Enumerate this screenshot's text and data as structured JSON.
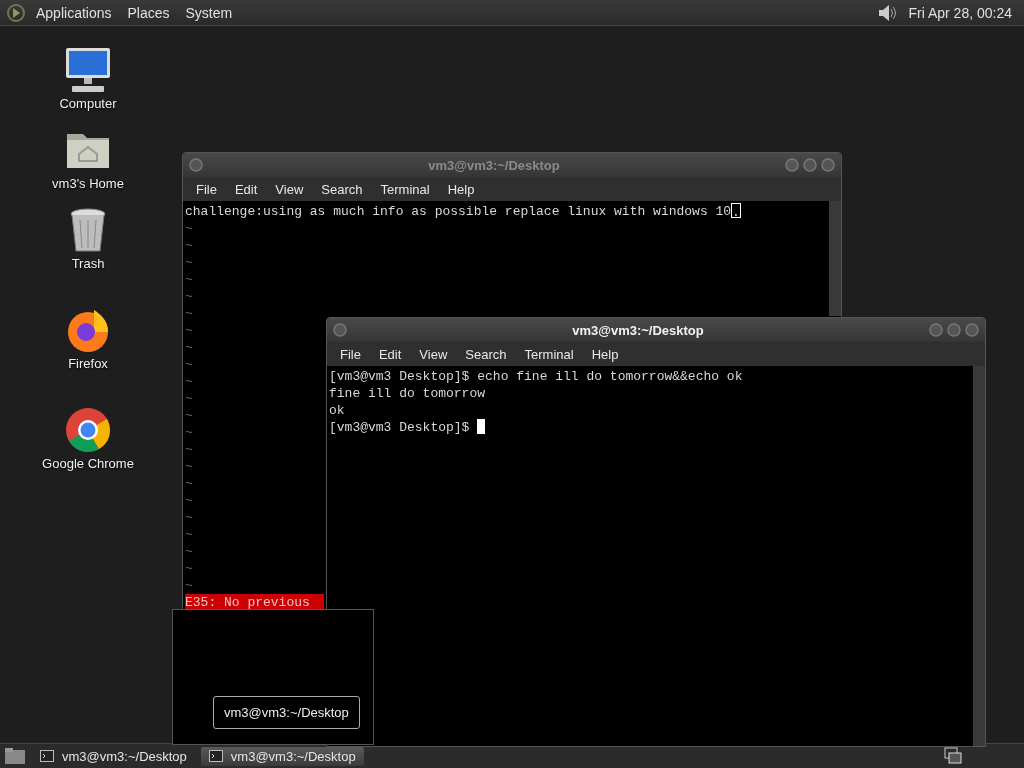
{
  "top_panel": {
    "menus": [
      {
        "label": "Applications"
      },
      {
        "label": "Places"
      },
      {
        "label": "System"
      }
    ],
    "clock": "Fri Apr 28, 00:24"
  },
  "desktop_icons": [
    {
      "kind": "computer",
      "label": "Computer"
    },
    {
      "kind": "home",
      "label": "vm3's Home"
    },
    {
      "kind": "trash",
      "label": "Trash"
    },
    {
      "kind": "firefox",
      "label": "Firefox"
    },
    {
      "kind": "chrome",
      "label": "Google Chrome"
    }
  ],
  "windows": [
    {
      "title": "vm3@vm3:~/Desktop",
      "active": false,
      "menu": [
        "File",
        "Edit",
        "View",
        "Search",
        "Terminal",
        "Help"
      ],
      "status_line": "E35: No previous",
      "lines": [
        {
          "kind": "text",
          "text": "challenge:using as much info as possible replace linux with windows 10",
          "cursor": true,
          "under_cursor": "."
        },
        {
          "kind": "filler",
          "text": "~"
        },
        {
          "kind": "filler",
          "text": "~"
        },
        {
          "kind": "filler",
          "text": "~"
        },
        {
          "kind": "filler",
          "text": "~"
        },
        {
          "kind": "filler",
          "text": "~"
        },
        {
          "kind": "filler",
          "text": "~"
        },
        {
          "kind": "filler",
          "text": "~"
        },
        {
          "kind": "filler",
          "text": "~"
        },
        {
          "kind": "filler",
          "text": "~"
        },
        {
          "kind": "filler",
          "text": "~"
        },
        {
          "kind": "filler",
          "text": "~"
        },
        {
          "kind": "filler",
          "text": "~"
        },
        {
          "kind": "filler",
          "text": "~"
        },
        {
          "kind": "filler",
          "text": "~"
        },
        {
          "kind": "filler",
          "text": "~"
        },
        {
          "kind": "filler",
          "text": "~"
        },
        {
          "kind": "filler",
          "text": "~"
        },
        {
          "kind": "filler",
          "text": "~"
        },
        {
          "kind": "filler",
          "text": "~"
        },
        {
          "kind": "filler",
          "text": "~"
        },
        {
          "kind": "filler",
          "text": "~"
        },
        {
          "kind": "filler",
          "text": "~"
        }
      ]
    },
    {
      "title": "vm3@vm3:~/Desktop",
      "active": true,
      "menu": [
        "File",
        "Edit",
        "View",
        "Search",
        "Terminal",
        "Help"
      ],
      "lines": [
        {
          "kind": "text",
          "text": "[vm3@vm3 Desktop]$ echo fine ill do tomorrow&&echo ok"
        },
        {
          "kind": "text",
          "text": "fine ill do tomorrow"
        },
        {
          "kind": "text",
          "text": "ok"
        },
        {
          "kind": "text",
          "text": "[vm3@vm3 Desktop]$ ",
          "cursor": true
        }
      ]
    }
  ],
  "task_preview": {
    "tooltip": "vm3@vm3:~/Desktop"
  },
  "taskbar": {
    "tasks": [
      {
        "label": "vm3@vm3:~/Desktop",
        "selected": false
      },
      {
        "label": "vm3@vm3:~/Desktop",
        "selected": true
      }
    ]
  }
}
